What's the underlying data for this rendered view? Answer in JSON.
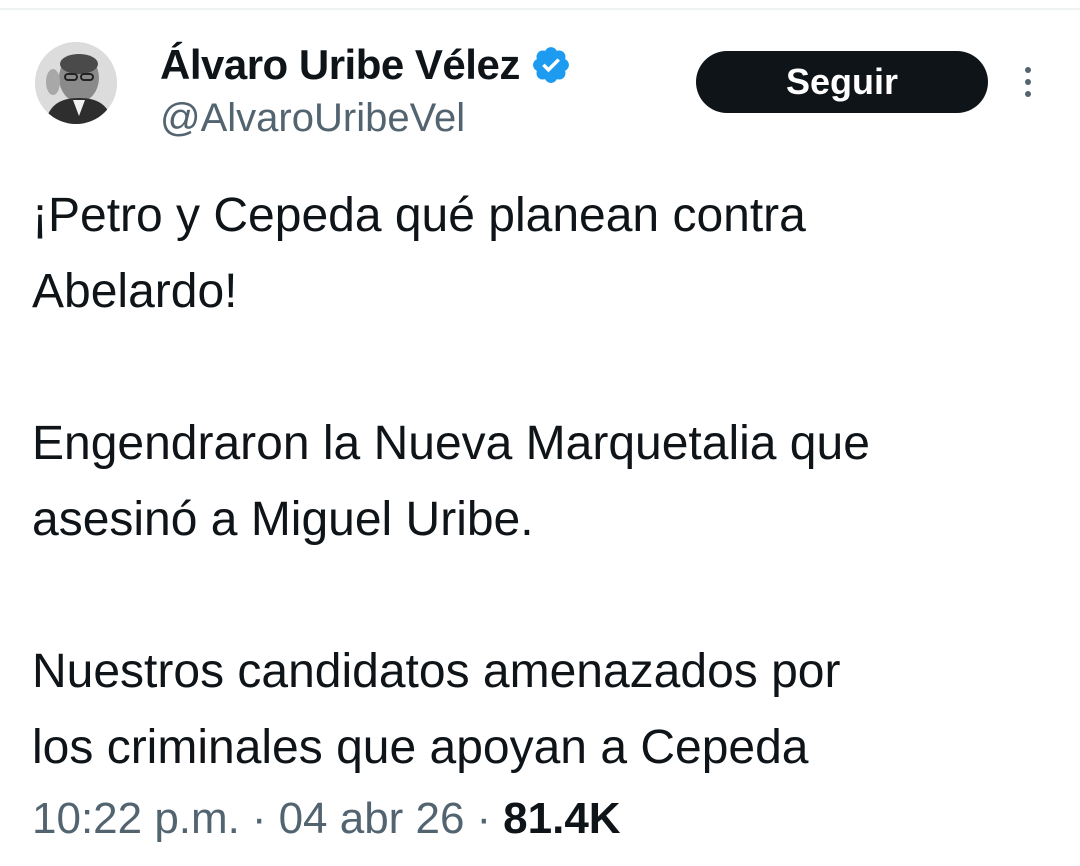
{
  "tweet": {
    "author": {
      "display_name": "Álvaro Uribe Vélez",
      "handle": "@AlvaroUribeVel",
      "verified": true,
      "avatar": "profile-photo"
    },
    "follow_label": "Seguir",
    "text": {
      "line1": "¡Petro y Cepeda qué planean contra",
      "line2": "Abelardo!",
      "line3": "Engendraron la Nueva Marquetalia que",
      "line4": "asesinó a Miguel Uribe.",
      "line5": "Nuestros candidatos amenazados por",
      "line6": "los criminales que apoyan a Cepeda"
    },
    "meta": {
      "time": "10:22 p.m.",
      "separator": "·",
      "date": "04 abr 26",
      "views": "81.4K"
    }
  },
  "colors": {
    "text": "#0f1419",
    "secondary": "#536471",
    "verified_badge": "#1d9bf0",
    "follow_button_bg": "#0f1419",
    "follow_button_text": "#ffffff"
  },
  "icons": {
    "verified": "verified-badge-icon",
    "more": "more-vertical-icon"
  }
}
